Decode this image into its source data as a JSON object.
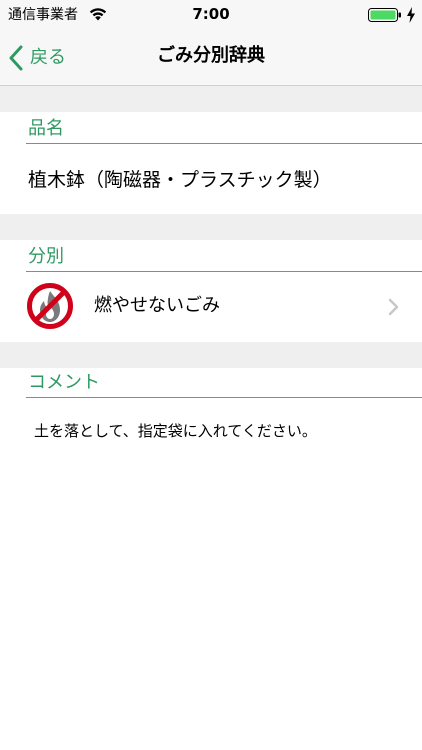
{
  "status_bar": {
    "carrier": "通信事業者",
    "time": "7:00"
  },
  "nav": {
    "back_label": "戻る",
    "title": "ごみ分別辞典"
  },
  "sections": {
    "item": {
      "header": "品名",
      "value": "植木鉢（陶磁器・プラスチック製）"
    },
    "category": {
      "header": "分別",
      "value": "燃やせないごみ"
    },
    "comment": {
      "header": "コメント",
      "value": "土を落として、指定袋に入れてください。"
    }
  },
  "colors": {
    "accent": "#2e9a62",
    "prohibit_red": "#d0021b",
    "separator_gray": "#efefef",
    "battery_green": "#4cd964"
  },
  "icons": {
    "wifi": "wifi-icon",
    "battery": "battery-icon",
    "charging": "charging-bolt-icon",
    "back": "chevron-left-icon",
    "category": "no-burn-icon",
    "disclosure": "chevron-right-icon"
  }
}
